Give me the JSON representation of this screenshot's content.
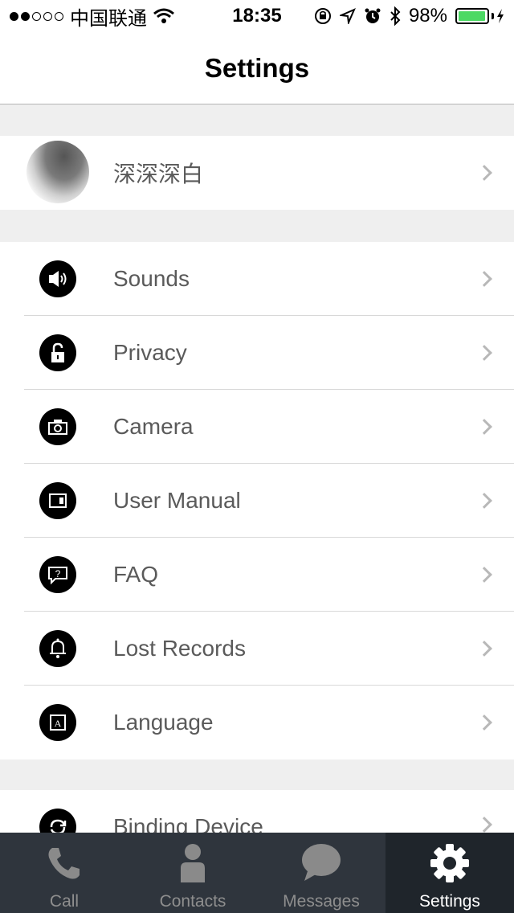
{
  "status_bar": {
    "carrier": "中国联通",
    "time": "18:35",
    "battery_percent": "98%",
    "battery_level": 0.98,
    "signal_bars_filled": 2,
    "signal_bars_total": 5
  },
  "nav": {
    "title": "Settings"
  },
  "profile": {
    "name": "深深深白"
  },
  "settings_items": [
    {
      "label": "Sounds",
      "icon": "speaker-icon"
    },
    {
      "label": "Privacy",
      "icon": "lock-icon"
    },
    {
      "label": "Camera",
      "icon": "camera-icon"
    },
    {
      "label": "User Manual",
      "icon": "manual-icon"
    },
    {
      "label": "FAQ",
      "icon": "question-bubble-icon"
    },
    {
      "label": "Lost Records",
      "icon": "bell-icon"
    },
    {
      "label": "Language",
      "icon": "language-icon"
    }
  ],
  "binding": {
    "label": "Binding Device",
    "icon": "refresh-icon"
  },
  "tabs": [
    {
      "label": "Call",
      "icon": "phone-icon",
      "active": false
    },
    {
      "label": "Contacts",
      "icon": "person-icon",
      "active": false
    },
    {
      "label": "Messages",
      "icon": "chat-bubble-icon",
      "active": false
    },
    {
      "label": "Settings",
      "icon": "gear-icon",
      "active": true
    }
  ],
  "colors": {
    "battery_fill": "#4cd964",
    "tab_bar": "#2f353d",
    "tab_active": "#1f252b"
  }
}
